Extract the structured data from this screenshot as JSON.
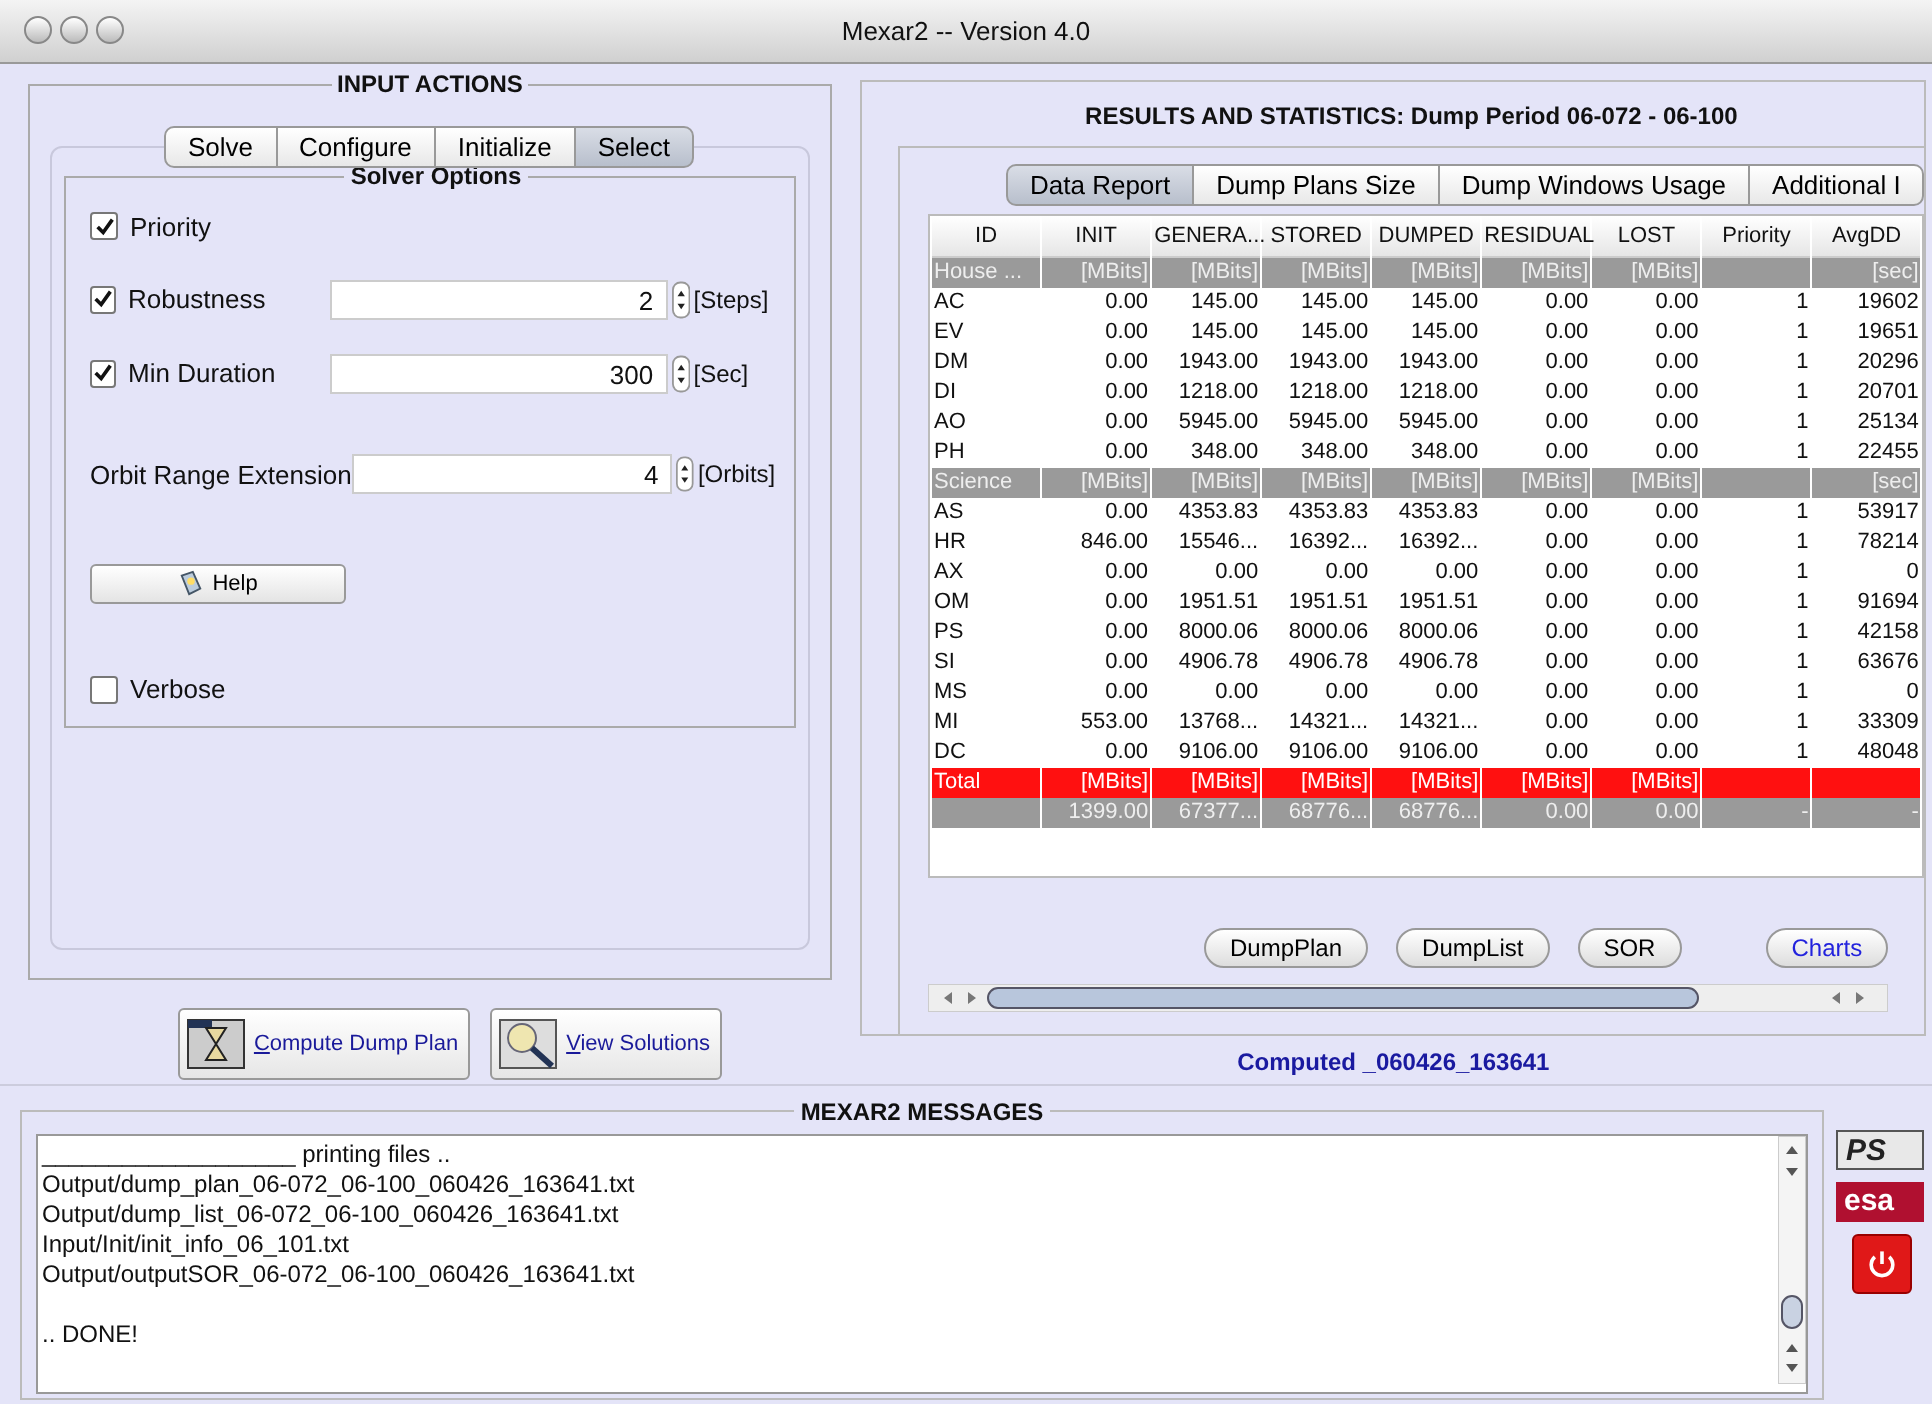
{
  "window": {
    "title": "Mexar2 -- Version 4.0"
  },
  "input_actions": {
    "title": "INPUT ACTIONS",
    "tabs": [
      {
        "label": "Solve",
        "selected": false
      },
      {
        "label": "Configure",
        "selected": false
      },
      {
        "label": "Initialize",
        "selected": false
      },
      {
        "label": "Select",
        "selected": true
      }
    ],
    "solver_options": {
      "title": "Solver Options",
      "options": [
        {
          "kind": "check",
          "label": "Priority",
          "checked": true
        },
        {
          "kind": "check-spinner",
          "label": "Robustness",
          "checked": true,
          "value": "2",
          "unit": "[Steps]"
        },
        {
          "kind": "check-spinner",
          "label": "Min Duration",
          "checked": true,
          "value": "300",
          "unit": "[Sec]"
        },
        {
          "kind": "spinner",
          "label": "Orbit Range Extension",
          "value": "4",
          "unit": "[Orbits]"
        },
        {
          "kind": "button",
          "label": "Help"
        },
        {
          "kind": "check",
          "label": "Verbose",
          "checked": false
        }
      ]
    },
    "actions": [
      {
        "kind": "compute",
        "label": "Compute Dump Plan"
      },
      {
        "kind": "view",
        "label": "View Solutions"
      }
    ]
  },
  "results": {
    "title": "RESULTS AND STATISTICS: Dump Period 06-072 - 06-100",
    "tabs": [
      {
        "label": "Data Report",
        "selected": true
      },
      {
        "label": "Dump Plans Size",
        "selected": false
      },
      {
        "label": "Dump Windows Usage",
        "selected": false
      },
      {
        "label": "Additional I",
        "selected": false
      }
    ],
    "table": {
      "columns": [
        "ID",
        "INIT",
        "GENERA...",
        "STORED",
        "DUMPED",
        "RESIDUAL",
        "LOST",
        "Priority",
        "AvgDD"
      ],
      "rows": [
        {
          "kind": "group",
          "cells": [
            "House ...",
            "[MBits]",
            "[MBits]",
            "[MBits]",
            "[MBits]",
            "[MBits]",
            "[MBits]",
            null,
            "[sec]"
          ]
        },
        {
          "kind": "data",
          "cells": [
            "AC",
            "0.00",
            "145.00",
            "145.00",
            "145.00",
            "0.00",
            "0.00",
            "1",
            "19602"
          ]
        },
        {
          "kind": "data",
          "cells": [
            "EV",
            "0.00",
            "145.00",
            "145.00",
            "145.00",
            "0.00",
            "0.00",
            "1",
            "19651"
          ]
        },
        {
          "kind": "data",
          "cells": [
            "DM",
            "0.00",
            "1943.00",
            "1943.00",
            "1943.00",
            "0.00",
            "0.00",
            "1",
            "20296"
          ]
        },
        {
          "kind": "data",
          "cells": [
            "DI",
            "0.00",
            "1218.00",
            "1218.00",
            "1218.00",
            "0.00",
            "0.00",
            "1",
            "20701"
          ]
        },
        {
          "kind": "data",
          "cells": [
            "AO",
            "0.00",
            "5945.00",
            "5945.00",
            "5945.00",
            "0.00",
            "0.00",
            "1",
            "25134"
          ]
        },
        {
          "kind": "data",
          "cells": [
            "PH",
            "0.00",
            "348.00",
            "348.00",
            "348.00",
            "0.00",
            "0.00",
            "1",
            "22455"
          ]
        },
        {
          "kind": "group",
          "cells": [
            "Science",
            "[MBits]",
            "[MBits]",
            "[MBits]",
            "[MBits]",
            "[MBits]",
            "[MBits]",
            null,
            "[sec]"
          ]
        },
        {
          "kind": "data",
          "cells": [
            "AS",
            "0.00",
            "4353.83",
            "4353.83",
            "4353.83",
            "0.00",
            "0.00",
            "1",
            "53917"
          ]
        },
        {
          "kind": "data",
          "cells": [
            "HR",
            "846.00",
            "15546...",
            "16392...",
            "16392...",
            "0.00",
            "0.00",
            "1",
            "78214"
          ]
        },
        {
          "kind": "data",
          "cells": [
            "AX",
            "0.00",
            "0.00",
            "0.00",
            "0.00",
            "0.00",
            "0.00",
            "1",
            "0"
          ]
        },
        {
          "kind": "data",
          "cells": [
            "OM",
            "0.00",
            "1951.51",
            "1951.51",
            "1951.51",
            "0.00",
            "0.00",
            "1",
            "91694"
          ]
        },
        {
          "kind": "data",
          "cells": [
            "PS",
            "0.00",
            "8000.06",
            "8000.06",
            "8000.06",
            "0.00",
            "0.00",
            "1",
            "42158"
          ]
        },
        {
          "kind": "data",
          "cells": [
            "SI",
            "0.00",
            "4906.78",
            "4906.78",
            "4906.78",
            "0.00",
            "0.00",
            "1",
            "63676"
          ]
        },
        {
          "kind": "data",
          "cells": [
            "MS",
            "0.00",
            "0.00",
            "0.00",
            "0.00",
            "0.00",
            "0.00",
            "1",
            "0"
          ]
        },
        {
          "kind": "data",
          "cells": [
            "MI",
            "553.00",
            "13768...",
            "14321...",
            "14321...",
            "0.00",
            "0.00",
            "1",
            "33309"
          ]
        },
        {
          "kind": "data",
          "cells": [
            "DC",
            "0.00",
            "9106.00",
            "9106.00",
            "9106.00",
            "0.00",
            "0.00",
            "1",
            "48048"
          ]
        },
        {
          "kind": "total",
          "cells": [
            "Total",
            "[MBits]",
            "[MBits]",
            "[MBits]",
            "[MBits]",
            "[MBits]",
            "[MBits]",
            null,
            null
          ]
        },
        {
          "kind": "summary",
          "cells": [
            null,
            "1399.00",
            "67377...",
            "68776...",
            "68776...",
            "0.00",
            "0.00",
            "-",
            "-"
          ]
        }
      ]
    },
    "buttons": [
      {
        "label": "DumpPlan",
        "highlighted": false
      },
      {
        "label": "DumpList",
        "highlighted": false
      },
      {
        "label": "SOR",
        "highlighted": false
      },
      {
        "label": "Charts",
        "highlighted": true
      }
    ],
    "status": "Computed _060426_163641"
  },
  "messages": {
    "title": "MEXAR2 MESSAGES",
    "lines": [
      {
        "kind": "text",
        "text": "___________________ printing files .."
      },
      {
        "kind": "text",
        "text": "Output/dump_plan_06-072_06-100_060426_163641.txt"
      },
      {
        "kind": "text",
        "text": "Output/dump_list_06-072_06-100_060426_163641.txt"
      },
      {
        "kind": "text",
        "text": "Input/Init/init_info_06_101.txt"
      },
      {
        "kind": "text",
        "text": "Output/outputSOR_06-072_06-100_060426_163641.txt"
      },
      {
        "kind": "blank"
      },
      {
        "kind": "text",
        "text": ".. DONE!"
      }
    ]
  },
  "logos": [
    "PS",
    "esa"
  ]
}
